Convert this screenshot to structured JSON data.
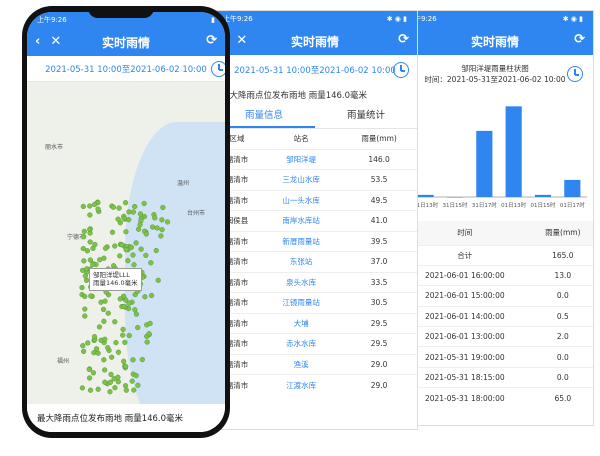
{
  "title": "实时雨情",
  "date_range": "2021-05-31 10:00至2021-06-02 10:00",
  "status_time": "上午9:26",
  "map": {
    "popup_line1": "邹阳洋堤LLL",
    "popup_line2": "雨量146.0毫米",
    "labels": [
      "温州",
      "台州市",
      "宁德市",
      "福州",
      "丽水市"
    ],
    "bottom_text": "最大降雨点位发布雨地 雨量146.0毫米"
  },
  "list": {
    "top_text": "最大降雨点位发布雨地 雨量146.0毫米",
    "tabs": [
      "雨量信息",
      "雨量统计"
    ],
    "headers": [
      "区域",
      "站名",
      "雨量(mm)"
    ],
    "rows": [
      [
        "福清市",
        "邹阳洋堤",
        "146.0"
      ],
      [
        "福清市",
        "三龙山水库",
        "53.5"
      ],
      [
        "福清市",
        "山一头水库",
        "49.5"
      ],
      [
        "闽侯县",
        "南岸水库站",
        "41.0"
      ],
      [
        "福清市",
        "新厝雨量站",
        "39.5"
      ],
      [
        "福清市",
        "东张站",
        "37.0"
      ],
      [
        "福清市",
        "泉头水库",
        "33.5"
      ],
      [
        "福清市",
        "江镜雨量站",
        "30.5"
      ],
      [
        "福清市",
        "大埔",
        "29.5"
      ],
      [
        "福清市",
        "赤水水库",
        "29.5"
      ],
      [
        "福清市",
        "渔溪",
        "29.0"
      ],
      [
        "福清市",
        "江渡水库",
        "29.0"
      ]
    ]
  },
  "detail": {
    "station_title": "邹阳洋堤雨量柱状图",
    "range_text": "时间：2021-05-31至2021-06-02 10:00",
    "table_headers": [
      "时间",
      "雨量(mm)"
    ],
    "rows": [
      [
        "合计",
        "165.0"
      ],
      [
        "2021-06-01 16:00:00",
        "13.0"
      ],
      [
        "2021-06-01 15:00:00",
        "0.0"
      ],
      [
        "2021-06-01 14:00:00",
        "0.5"
      ],
      [
        "2021-06-01 13:00:00",
        "2.0"
      ],
      [
        "2021-05-31 19:00:00",
        "0.0"
      ],
      [
        "2021-05-31 18:15:00",
        "0.0"
      ],
      [
        "2021-05-31 18:00:00",
        "65.0"
      ]
    ]
  },
  "chart_data": {
    "type": "bar",
    "categories": [
      "31日13时",
      "31日15时",
      "31日17时",
      "01日13时",
      "01日15时",
      "01日17时"
    ],
    "values": [
      2,
      0,
      62,
      85,
      2,
      16
    ],
    "ylim": [
      0,
      90
    ],
    "title": "",
    "xlabel": "",
    "ylabel": ""
  },
  "colors": {
    "accent": "#2f86f0",
    "map_points": "#7cc24a"
  }
}
